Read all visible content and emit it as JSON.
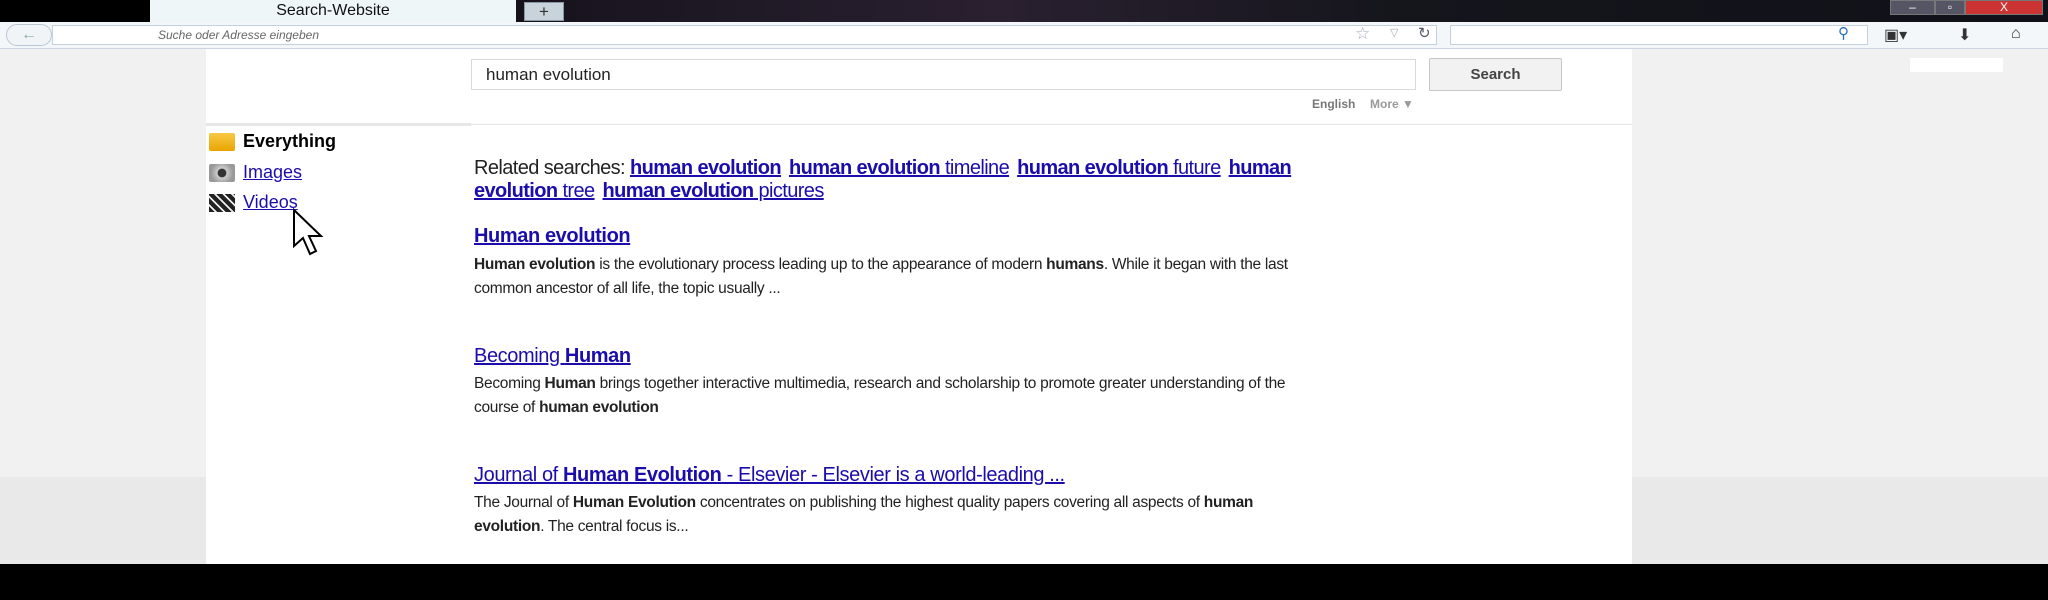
{
  "browser": {
    "tab_title": "Search-Website",
    "new_tab": "+",
    "url_placeholder": "Suche oder Adresse eingeben",
    "window_buttons": [
      "–",
      "▫",
      "X"
    ]
  },
  "search": {
    "query": "human evolution",
    "button": "Search",
    "language": "English",
    "more": "More ▼"
  },
  "sidebar": {
    "items": [
      {
        "label": "Everything",
        "icon": "folder-icon"
      },
      {
        "label": "Images",
        "icon": "camera-icon"
      },
      {
        "label": "Videos",
        "icon": "clapperboard-icon"
      }
    ]
  },
  "related": {
    "label": "Related searches:",
    "items": [
      {
        "b": "human evolution",
        "n": ""
      },
      {
        "b": "human evolution",
        "n": " timeline"
      },
      {
        "b": "human evolution",
        "n": " future"
      },
      {
        "b": "human evolution",
        "n": " tree"
      },
      {
        "b": "human evolution",
        "n": " pictures"
      }
    ]
  },
  "results": [
    {
      "title": [
        {
          "t": "Human evolution",
          "b": true
        }
      ],
      "snippet": [
        {
          "t": "Human evolution",
          "b": true
        },
        {
          "t": " is the evolutionary process leading up to the appearance of modern "
        },
        {
          "t": "humans",
          "b": true
        },
        {
          "t": ". While it began with the last common ancestor of all life, the topic usually ..."
        }
      ]
    },
    {
      "title": [
        {
          "t": "Becoming "
        },
        {
          "t": "Human",
          "b": true
        }
      ],
      "snippet": [
        {
          "t": "Becoming "
        },
        {
          "t": "Human",
          "b": true
        },
        {
          "t": " brings together interactive multimedia, research and scholarship to promote greater understanding of the course of "
        },
        {
          "t": "human evolution",
          "b": true
        }
      ]
    },
    {
      "title": [
        {
          "t": "Journal of "
        },
        {
          "t": "Human Evolution",
          "b": true
        },
        {
          "t": " - Elsevier - Elsevier is a world-leading ..."
        }
      ],
      "snippet": [
        {
          "t": "The Journal of "
        },
        {
          "t": "Human Evolution",
          "b": true
        },
        {
          "t": " concentrates on publishing the highest quality papers covering all aspects of "
        },
        {
          "t": "human evolution",
          "b": true
        },
        {
          "t": ". The central focus is..."
        }
      ]
    }
  ]
}
